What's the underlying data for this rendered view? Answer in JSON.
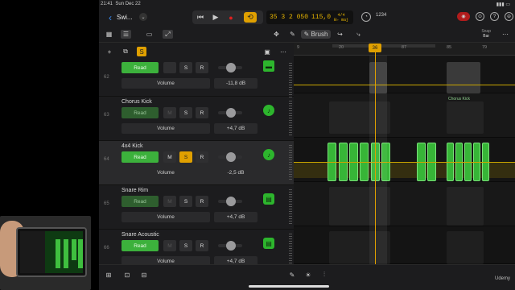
{
  "status": {
    "time": "21:41",
    "date": "Sun Dec 22"
  },
  "project": {
    "title": "Swi..."
  },
  "transport": {
    "rewind": "⏮",
    "play": "▶",
    "record": "●",
    "cycle": "⟲"
  },
  "lcd": {
    "position": "35 3 2 050",
    "tempo": "115,0",
    "sig_top": "4/4",
    "sig_bottom": "B♭ maj"
  },
  "toolbar": {
    "metronome": "◔",
    "countin": "1234",
    "right_icons": [
      "◉",
      "⊙",
      "?",
      "⊖"
    ]
  },
  "subbar": {
    "grid": "▦",
    "tracks": "☰",
    "window": "▭",
    "automation": "⤢",
    "move": "✥",
    "pencil": "✎",
    "brush": "✎ Brush",
    "curve": "↪",
    "catch": "⤷",
    "snap_label": "Snap",
    "snap_value": "Bar",
    "more": "⋯"
  },
  "track_header_bar": {
    "add": "+",
    "duplicate": "⧉",
    "solo": "S",
    "icon1": "▣",
    "icon2": "⋯"
  },
  "tracks": [
    {
      "num": "62",
      "name": "",
      "read": "Read",
      "mute": "",
      "solo": "S",
      "rec": "R",
      "param": "Volume",
      "value": "-11,8 dB",
      "instrument": "▬"
    },
    {
      "num": "63",
      "name": "Chorus Kick",
      "read": "Read",
      "mute": "M",
      "solo": "S",
      "rec": "R",
      "param": "Volume",
      "value": "+4,7 dB",
      "instrument": "♪"
    },
    {
      "num": "64",
      "name": "4x4 Kick",
      "read": "Read",
      "mute": "M",
      "solo": "S",
      "rec": "R",
      "param": "Volume",
      "value": "-2,5 dB",
      "instrument": "♪"
    },
    {
      "num": "65",
      "name": "Snare Rim",
      "read": "Read",
      "mute": "M",
      "solo": "S",
      "rec": "R",
      "param": "Volume",
      "value": "+4,7 dB",
      "instrument": "▤"
    },
    {
      "num": "66",
      "name": "Snare Acoustic",
      "read": "Read",
      "mute": "M",
      "solo": "S",
      "rec": "R",
      "param": "Volume",
      "value": "+4,7 dB",
      "instrument": "▤"
    }
  ],
  "ruler": {
    "marks": [
      "9",
      "20",
      "",
      "36",
      "",
      "87",
      "",
      "",
      "85",
      "",
      "79"
    ],
    "playhead": "36"
  },
  "timeline": {
    "chorus_kick_label": "Chorus Kick"
  },
  "bottombar": {
    "library": "⊞",
    "browser": "⊡",
    "editor": "⊟",
    "pen": "✎",
    "fx": "☀",
    "mixer": "⫶"
  },
  "watermark": "Udemy",
  "colors": {
    "accent": "#e0a000",
    "read_green": "#3cb13c",
    "record_red": "#e02020",
    "region_green": "#37b537"
  }
}
